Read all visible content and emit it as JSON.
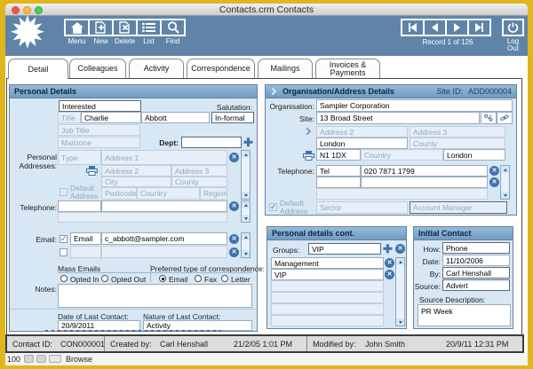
{
  "window": {
    "title": "Contacts.crm Contacts"
  },
  "toolbar": {
    "buttons": [
      {
        "label": "Menu",
        "icon": "home-icon"
      },
      {
        "label": "New",
        "icon": "new-record-icon"
      },
      {
        "label": "Delete",
        "icon": "delete-record-icon"
      },
      {
        "label": "List",
        "icon": "list-icon"
      },
      {
        "label": "Find",
        "icon": "find-icon"
      }
    ],
    "record_counter": "Record 1 of 126",
    "logout_line1": "Log",
    "logout_line2": "Out"
  },
  "tabs": [
    "Detail",
    "Colleagues",
    "Activity",
    "Correspondence",
    "Mailings",
    "Invoices & Payments"
  ],
  "personal_details": {
    "title": "Personal Details",
    "interested": "Interested",
    "salutation_label": "Salutation:",
    "salutation_value": "In-formal",
    "title_placeholder": "Title",
    "first_name": "Charlie",
    "last_name": "Abbott",
    "job_title_placeholder": "Job Title",
    "mailzone_placeholder": "Mailzone",
    "dept_label": "Dept:",
    "addresses_label_1": "Personal",
    "addresses_label_2": "Addresses:",
    "ph": {
      "type": "Type",
      "a1": "Address 1",
      "a2": "Address 2",
      "a3": "Address 3",
      "city": "City",
      "county": "County",
      "postcode": "Postcode",
      "country": "Country",
      "region": "Region",
      "default_1": "Default",
      "default_2": "Address"
    },
    "telephone_label": "Telephone:",
    "email_label": "Email:",
    "email_type": "Email",
    "email_value": "c_abbott@sampler.com",
    "mass_emails_label": "Mass Emails",
    "opted_in": "Opted In",
    "opted_out": "Opted Out",
    "preferred_label": "Preferred type of correspondence:",
    "pref_email": "Email",
    "pref_fax": "Fax",
    "pref_letter": "Letter",
    "notes_label": "Notes:",
    "last_date_label": "Date of Last Contact:",
    "last_date": "20/9/2011",
    "last_nature_label": "Nature of Last Contact:",
    "last_nature": "Activity"
  },
  "organisation": {
    "title": "Organisation/Address Details",
    "site_id_label": "Site ID:",
    "site_id": "ADD000004",
    "organisation_label": "Organisation:",
    "organisation": "Sampler Corporation",
    "site_label": "Site:",
    "address1": "13 Broad Street",
    "address2_ph": "Address 2",
    "address3_ph": "Address 3",
    "city": "London",
    "county_ph": "County",
    "postcode": "N1 1DX",
    "country_ph": "Country",
    "region": "London",
    "telephone_label": "Telephone:",
    "phone_type": "Tel",
    "phone_number": "020 7871 1799",
    "default_1": "Default",
    "default_2": "Address",
    "sector_ph": "Sector",
    "account_manager_ph": "Account Manager"
  },
  "personal_cont": {
    "title": "Personal details cont.",
    "groups_label": "Groups:",
    "groups_input": "VIP",
    "group_1": "Management",
    "group_2": "VIP"
  },
  "initial_contact": {
    "title": "Initial Contact",
    "how_label": "How:",
    "how": "Phone",
    "date_label": "Date:",
    "date": "11/10/2006",
    "by_label": "By:",
    "by": "Carl Henshall",
    "source_label": "Source:",
    "source": "Advert",
    "source_desc_label": "Source Description:",
    "source_desc": "PR Week"
  },
  "status_bar": {
    "contact_id_label": "Contact ID:",
    "contact_id": "CON000001",
    "created_by_label": "Created by:",
    "created_by": "Carl Henshall",
    "created_at": "21/2/05 1:01 PM",
    "modified_by_label": "Modified by:",
    "modified_by": "John Smith",
    "modified_at": "20/9/11 12:31 PM"
  },
  "bottom_bar": {
    "zoom_level": "100",
    "mode": "Browse"
  }
}
